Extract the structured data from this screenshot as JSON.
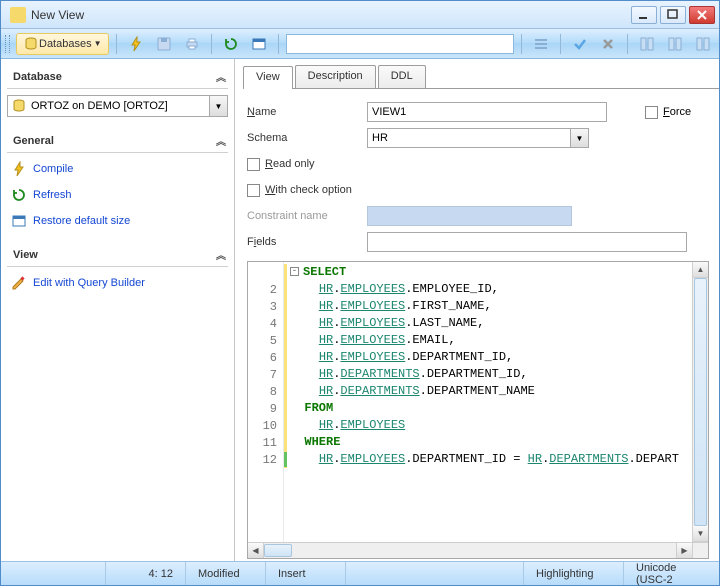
{
  "window": {
    "title": "New View"
  },
  "toolbar": {
    "databases_label": "Databases"
  },
  "sidebar": {
    "database": {
      "title": "Database",
      "selected": "ORTOZ on DEMO [ORTOZ]"
    },
    "general": {
      "title": "General",
      "compile": "Compile",
      "refresh": "Refresh",
      "restore": "Restore default size"
    },
    "view": {
      "title": "View",
      "edit_qb": "Edit with Query Builder"
    }
  },
  "tabs": {
    "view": "View",
    "description": "Description",
    "ddl": "DDL"
  },
  "form": {
    "name_label": "Name",
    "name_value": "VIEW1",
    "force_label": "Force",
    "schema_label": "Schema",
    "schema_value": "HR",
    "read_only_label": "Read only",
    "check_option_label": "With check option",
    "constraint_label": "Constraint name",
    "fields_label": "Fields"
  },
  "editor": {
    "lines": [
      "SELECT",
      "  HR.EMPLOYEES.EMPLOYEE_ID,",
      "  HR.EMPLOYEES.FIRST_NAME,",
      "  HR.EMPLOYEES.LAST_NAME,",
      "  HR.EMPLOYEES.EMAIL,",
      "  HR.EMPLOYEES.DEPARTMENT_ID,",
      "  HR.DEPARTMENTS.DEPARTMENT_ID,",
      "  HR.DEPARTMENTS.DEPARTMENT_NAME",
      "FROM",
      "  HR.EMPLOYEES",
      "WHERE",
      "  HR.EMPLOYEES.DEPARTMENT_ID = HR.DEPARTMENTS.DEPART"
    ]
  },
  "status": {
    "pos": "4:  12",
    "modified": "Modified",
    "insert": "Insert",
    "highlighting": "Highlighting",
    "encoding": "Unicode (USC-2"
  }
}
